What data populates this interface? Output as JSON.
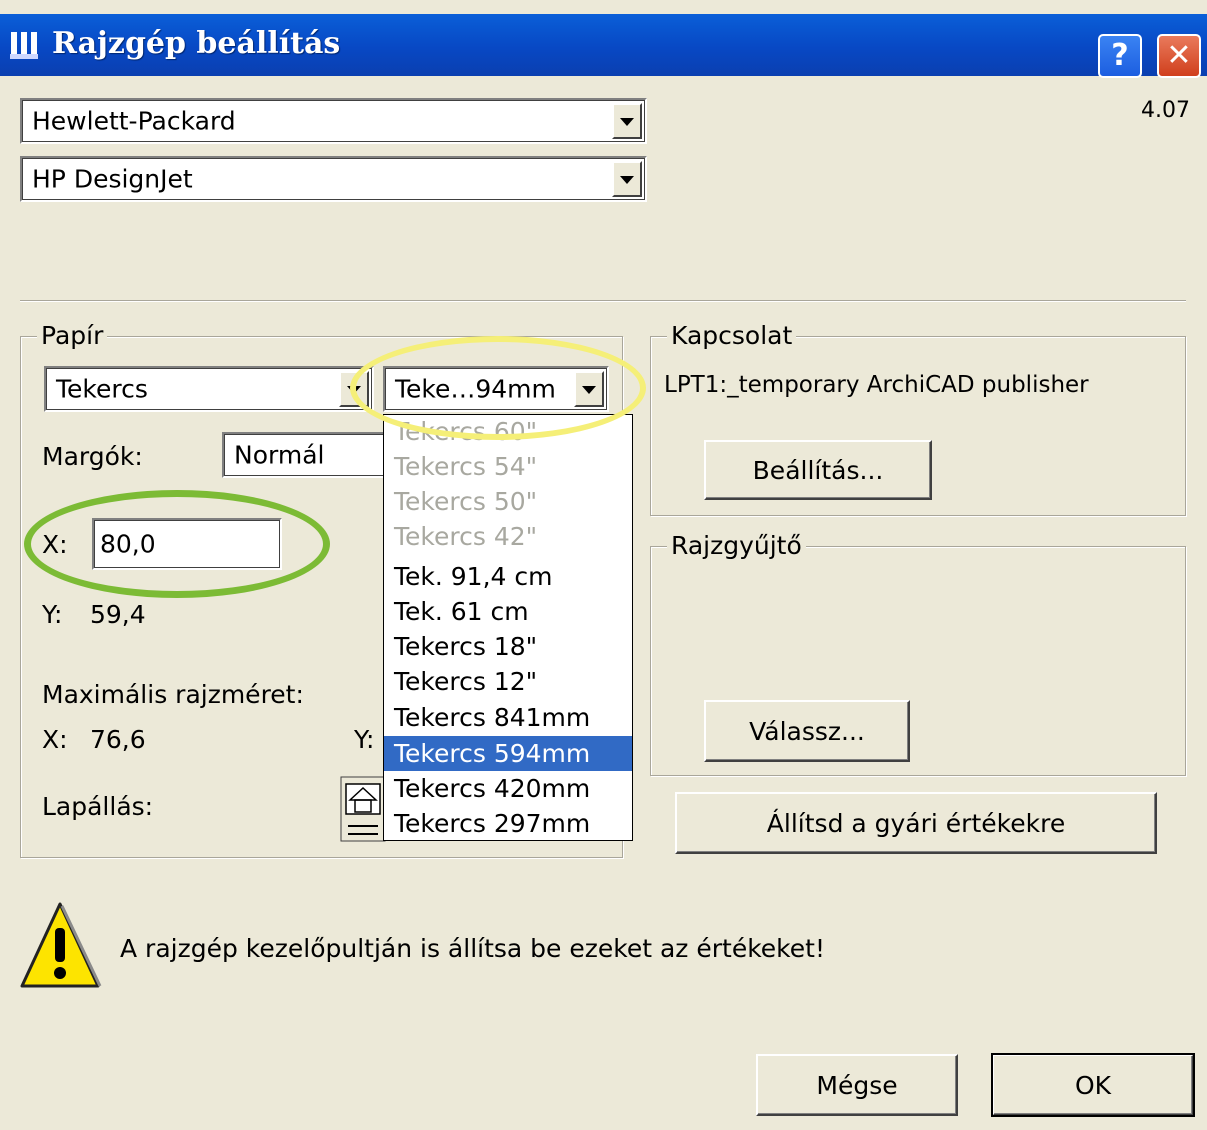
{
  "window": {
    "title": "Rajzgép beállítás",
    "version": "4.07",
    "help_label": "?",
    "close_label": "✕"
  },
  "manufacturer": {
    "selected": "Hewlett-Packard"
  },
  "model": {
    "selected": "HP DesignJet"
  },
  "paper": {
    "group_label": "Papír",
    "type": {
      "selected": "Tekercs"
    },
    "size": {
      "selected": "Teke…94mm",
      "options": [
        {
          "label": "Tekercs 60\"",
          "enabled": false
        },
        {
          "label": "Tekercs 54\"",
          "enabled": false
        },
        {
          "label": "Tekercs 50\"",
          "enabled": false
        },
        {
          "label": "Tekercs 42\"",
          "enabled": false
        },
        {
          "label": "Tek. 91,4 cm",
          "enabled": true
        },
        {
          "label": "Tek. 61 cm",
          "enabled": true
        },
        {
          "label": "Tekercs 18\"",
          "enabled": true
        },
        {
          "label": "Tekercs 12\"",
          "enabled": true
        },
        {
          "label": "Tekercs 841mm",
          "enabled": true
        },
        {
          "label": "Tekercs 594mm",
          "enabled": true,
          "selected": true
        },
        {
          "label": "Tekercs 420mm",
          "enabled": true
        },
        {
          "label": "Tekercs 297mm",
          "enabled": true
        }
      ]
    },
    "margins_label": "Margók:",
    "margins_value": "Normál",
    "x_label": "X:",
    "x_value": "80,0",
    "y_label": "Y:",
    "y_value": "59,4",
    "max_size_label": "Maximális rajzméret:",
    "max_x_label": "X:",
    "max_x_value": "76,6",
    "max_y_label": "Y:",
    "orientation_label": "Lapállás:"
  },
  "connection": {
    "group_label": "Kapcsolat",
    "port": "LPT1:_temporary ArchiCAD publisher",
    "settings_button": "Beállítás..."
  },
  "spooler": {
    "group_label": "Rajzgyűjtő",
    "choose_button": "Válassz..."
  },
  "reset_button": "Állítsd a gyári értékekre",
  "warning": {
    "icon": "warning-icon",
    "text": "A rajzgép kezelőpultján is állítsa be ezeket az értékeket!"
  },
  "buttons": {
    "cancel": "Mégse",
    "ok": "OK"
  },
  "annotations": {
    "yellow": "#f5ef78",
    "green": "#7cbb35"
  },
  "colors": {
    "titlebar": "#0848c4",
    "dialog": "#ece9d8",
    "selection": "#316ac5"
  }
}
